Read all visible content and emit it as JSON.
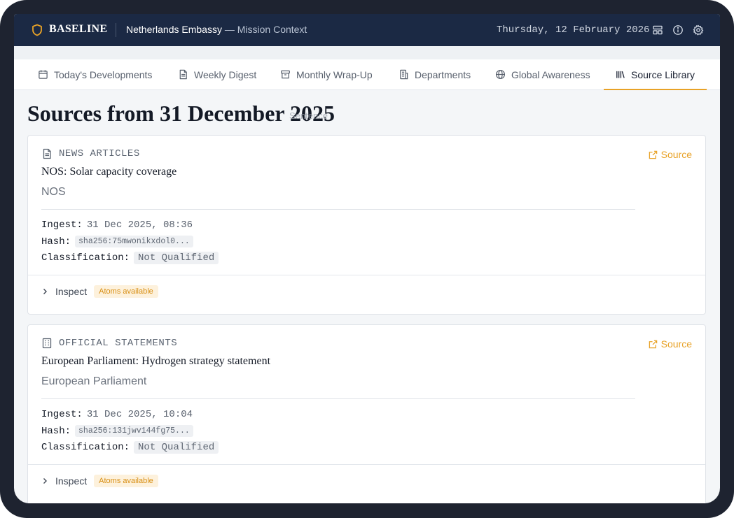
{
  "header": {
    "brand": "BASELINE",
    "context": "Netherlands Embassy",
    "context_suffix": "— Mission Context",
    "date": "Thursday, 12 February 2026",
    "icons": [
      "layout-icon",
      "info-icon",
      "settings-icon"
    ]
  },
  "tabs": [
    {
      "label": "Today's Developments",
      "icon": "calendar-icon",
      "active": false
    },
    {
      "label": "Weekly Digest",
      "icon": "document-icon",
      "active": false
    },
    {
      "label": "Monthly Wrap-Up",
      "icon": "archive-icon",
      "active": false
    },
    {
      "label": "Departments",
      "icon": "building-icon",
      "active": false
    },
    {
      "label": "Global Awareness",
      "icon": "globe-icon",
      "active": false
    },
    {
      "label": "Source Library",
      "icon": "library-icon",
      "active": true
    }
  ],
  "page": {
    "title": "Sources from 31 December 2025",
    "ghost_label": "Sentence"
  },
  "sources": [
    {
      "category": "NEWS ARTICLES",
      "category_icon": "document-icon",
      "source_link": "Source",
      "headline": "NOS: Solar capacity coverage",
      "publisher": "NOS",
      "ingest_label": "Ingest:",
      "ingest": "31 Dec 2025, 08:36",
      "hash_label": "Hash:",
      "hash": "sha256:75mwonikxdol0...",
      "classification_label": "Classification:",
      "classification": "Not Qualified",
      "inspect_label": "Inspect",
      "badge": "Atoms available"
    },
    {
      "category": "OFFICIAL STATEMENTS",
      "category_icon": "building-icon",
      "source_link": "Source",
      "headline": "European Parliament: Hydrogen strategy statement",
      "publisher": "European Parliament",
      "ingest_label": "Ingest:",
      "ingest": "31 Dec 2025, 10:04",
      "hash_label": "Hash:",
      "hash": "sha256:131jwv144fg75...",
      "classification_label": "Classification:",
      "classification": "Not Qualified",
      "inspect_label": "Inspect",
      "badge": "Atoms available"
    }
  ],
  "colors": {
    "header_bg": "#1b2944",
    "accent": "#e8a227",
    "text": "#141a26",
    "muted": "#6b727d"
  }
}
